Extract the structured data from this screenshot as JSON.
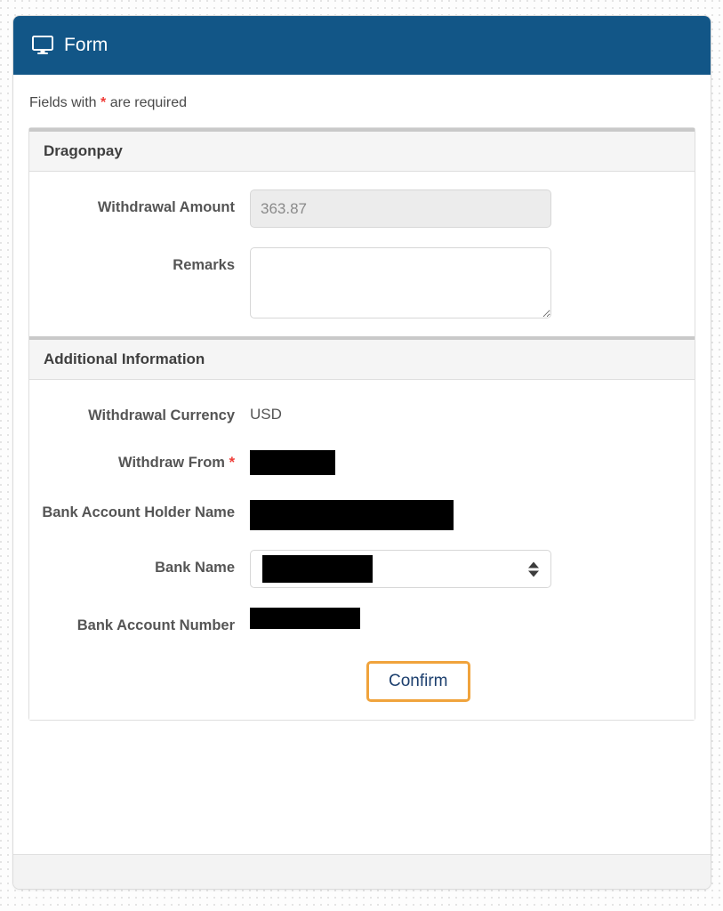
{
  "window": {
    "title": "Form",
    "icon": "desktop-monitor-icon",
    "header_bg": "#125687",
    "header_text_color": "#ffffff"
  },
  "form": {
    "required_note_prefix": "Fields with ",
    "required_note_star": "*",
    "required_note_suffix": " are required",
    "required_star_color": "#ef3b36"
  },
  "panels": [
    {
      "title": "Dragonpay",
      "fields": [
        {
          "label": "Withdrawal Amount",
          "type": "text-input-disabled",
          "value": "363.87",
          "placeholder": "",
          "required": false,
          "redacted": false
        },
        {
          "label": "Remarks",
          "type": "textarea",
          "value": "",
          "placeholder": "",
          "required": false,
          "redacted": false
        }
      ]
    },
    {
      "title": "Additional Information",
      "fields": [
        {
          "label": "Withdrawal Currency",
          "type": "static-text",
          "value": "USD",
          "placeholder": "",
          "required": false,
          "redacted": false
        },
        {
          "label": "Withdraw From",
          "type": "redacted-value",
          "value": "",
          "placeholder": "",
          "required": true,
          "redacted": true
        },
        {
          "label": "Bank Account Holder Name",
          "type": "redacted-value",
          "value": "",
          "placeholder": "",
          "required": false,
          "redacted": true
        },
        {
          "label": "Bank Name",
          "type": "select",
          "value": "",
          "placeholder": "",
          "required": false,
          "redacted": true
        },
        {
          "label": "Bank Account Number",
          "type": "text-input",
          "value": "",
          "placeholder": "",
          "required": false,
          "redacted": true
        }
      ]
    }
  ],
  "actions": {
    "confirm_label": "Confirm",
    "confirm_border_color": "#f0a33c",
    "confirm_text_color": "#1c3f6e"
  }
}
